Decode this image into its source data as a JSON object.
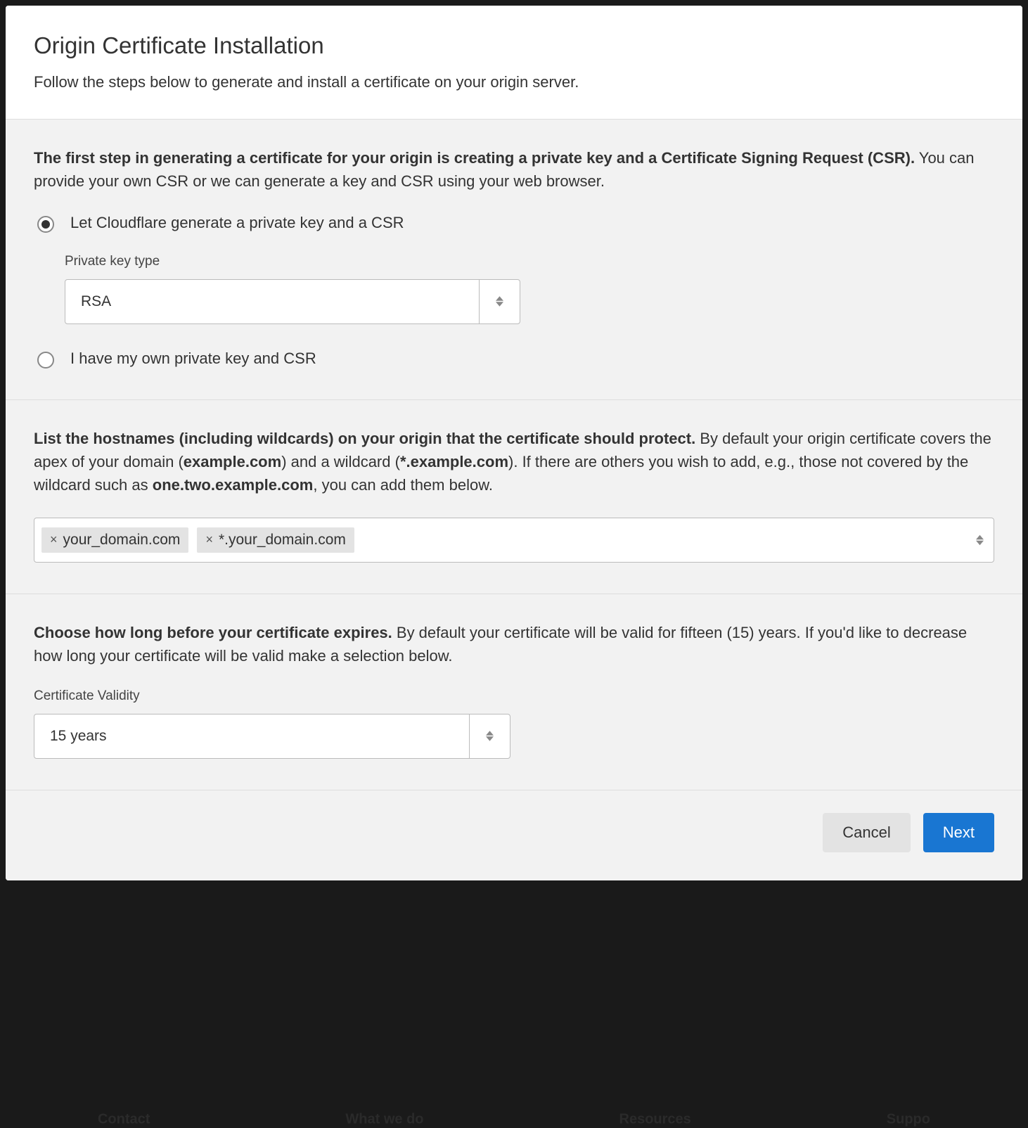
{
  "header": {
    "title": "Origin Certificate Installation",
    "subtitle": "Follow the steps below to generate and install a certificate on your origin server."
  },
  "step1": {
    "intro_bold": "The first step in generating a certificate for your origin is creating a private key and a Certificate Signing Request (CSR).",
    "intro_rest": " You can provide your own CSR or we can generate a key and CSR using your web browser.",
    "radio_generate": "Let Cloudflare generate a private key and a CSR",
    "radio_own": "I have my own private key and CSR",
    "private_key_label": "Private key type",
    "private_key_value": "RSA",
    "radio_selected": "generate"
  },
  "step2": {
    "intro_bold1": "List the hostnames (including wildcards) on your origin that the certificate should protect.",
    "intro_plain1": " By default your origin certificate covers the apex of your domain (",
    "intro_bold2": "example.com",
    "intro_plain2": ") and a wildcard (",
    "intro_bold3": "*.example.com",
    "intro_plain3": "). If there are others you wish to add, e.g., those not covered by the wildcard such as ",
    "intro_bold4": "one.two.example.com",
    "intro_plain4": ", you can add them below.",
    "hostnames": [
      "your_domain.com",
      "*.your_domain.com"
    ]
  },
  "step3": {
    "intro_bold": "Choose how long before your certificate expires.",
    "intro_rest": " By default your certificate will be valid for fifteen (15) years. If you'd like to decrease how long your certificate will be valid make a selection below.",
    "validity_label": "Certificate Validity",
    "validity_value": "15 years"
  },
  "footer": {
    "cancel": "Cancel",
    "next": "Next"
  },
  "background_nav": {
    "a": "Contact",
    "b": "What we do",
    "c": "Resources",
    "d": "Suppo"
  }
}
